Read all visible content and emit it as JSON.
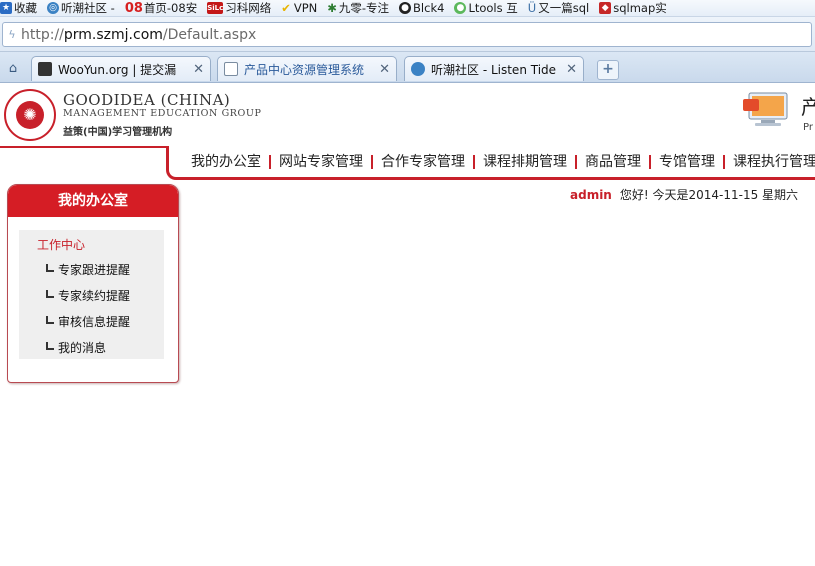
{
  "bookmarks": [
    {
      "label": "收藏",
      "icon": "star-icon",
      "color": "#2b6cc4"
    },
    {
      "label": "听潮社区 -",
      "icon": "globe-icon",
      "color": "#3b82c4"
    },
    {
      "label": "首页-08安",
      "icon": "site-08-icon",
      "color": "#d62020",
      "badge": "08"
    },
    {
      "label": "习科网络",
      "icon": "site-silc-icon",
      "color": "#c41818",
      "badge": "SiLc"
    },
    {
      "label": "VPN",
      "icon": "check-icon",
      "color": "#e8b400"
    },
    {
      "label": "九零-专注",
      "icon": "leaf-icon",
      "color": "#2e7d32"
    },
    {
      "label": "Blck4",
      "icon": "github-icon",
      "color": "#222222"
    },
    {
      "label": "Ltools 互",
      "icon": "chat-icon",
      "color": "#5cb85c"
    },
    {
      "label": "又一篇sql",
      "icon": "shield-outline-icon",
      "color": "#3a6ea5"
    },
    {
      "label": "sqlmap实",
      "icon": "shield-icon",
      "color": "#c62828"
    }
  ],
  "address": {
    "scheme": "http://",
    "host": "prm.szmj.com",
    "path": "/Default.aspx"
  },
  "tabs": [
    {
      "label": "WooYun.org | 提交漏",
      "icon": "wooyun-icon",
      "close": "✕"
    },
    {
      "label": "产品中心资源管理系统",
      "icon": "document-icon",
      "close": "✕"
    },
    {
      "label": "听潮社区 - Listen Tide",
      "icon": "globe-icon",
      "close": "✕"
    }
  ],
  "newtab_label": "+",
  "home_label": "⌂",
  "brand": {
    "name_en": "GOODIDEA (CHINA)",
    "sub_en": "MANAGEMENT EDUCATION GROUP",
    "name_cn": "益策(中国)学习管理机构",
    "product_cn": "产",
    "product_en": "Pr"
  },
  "nav": [
    "我的办公室",
    "网站专家管理",
    "合作专家管理",
    "课程排期管理",
    "商品管理",
    "专馆管理",
    "课程执行管理"
  ],
  "greeting": {
    "user": "admin",
    "text": "您好! 今天是2014-11-15 星期六"
  },
  "sidebar": {
    "title": "我的办公室",
    "section": "工作中心",
    "items": [
      "专家跟进提醒",
      "专家续约提醒",
      "审核信息提醒",
      "我的消息"
    ]
  },
  "colors": {
    "accent": "#c8202a",
    "panel_head": "#d51d25"
  }
}
